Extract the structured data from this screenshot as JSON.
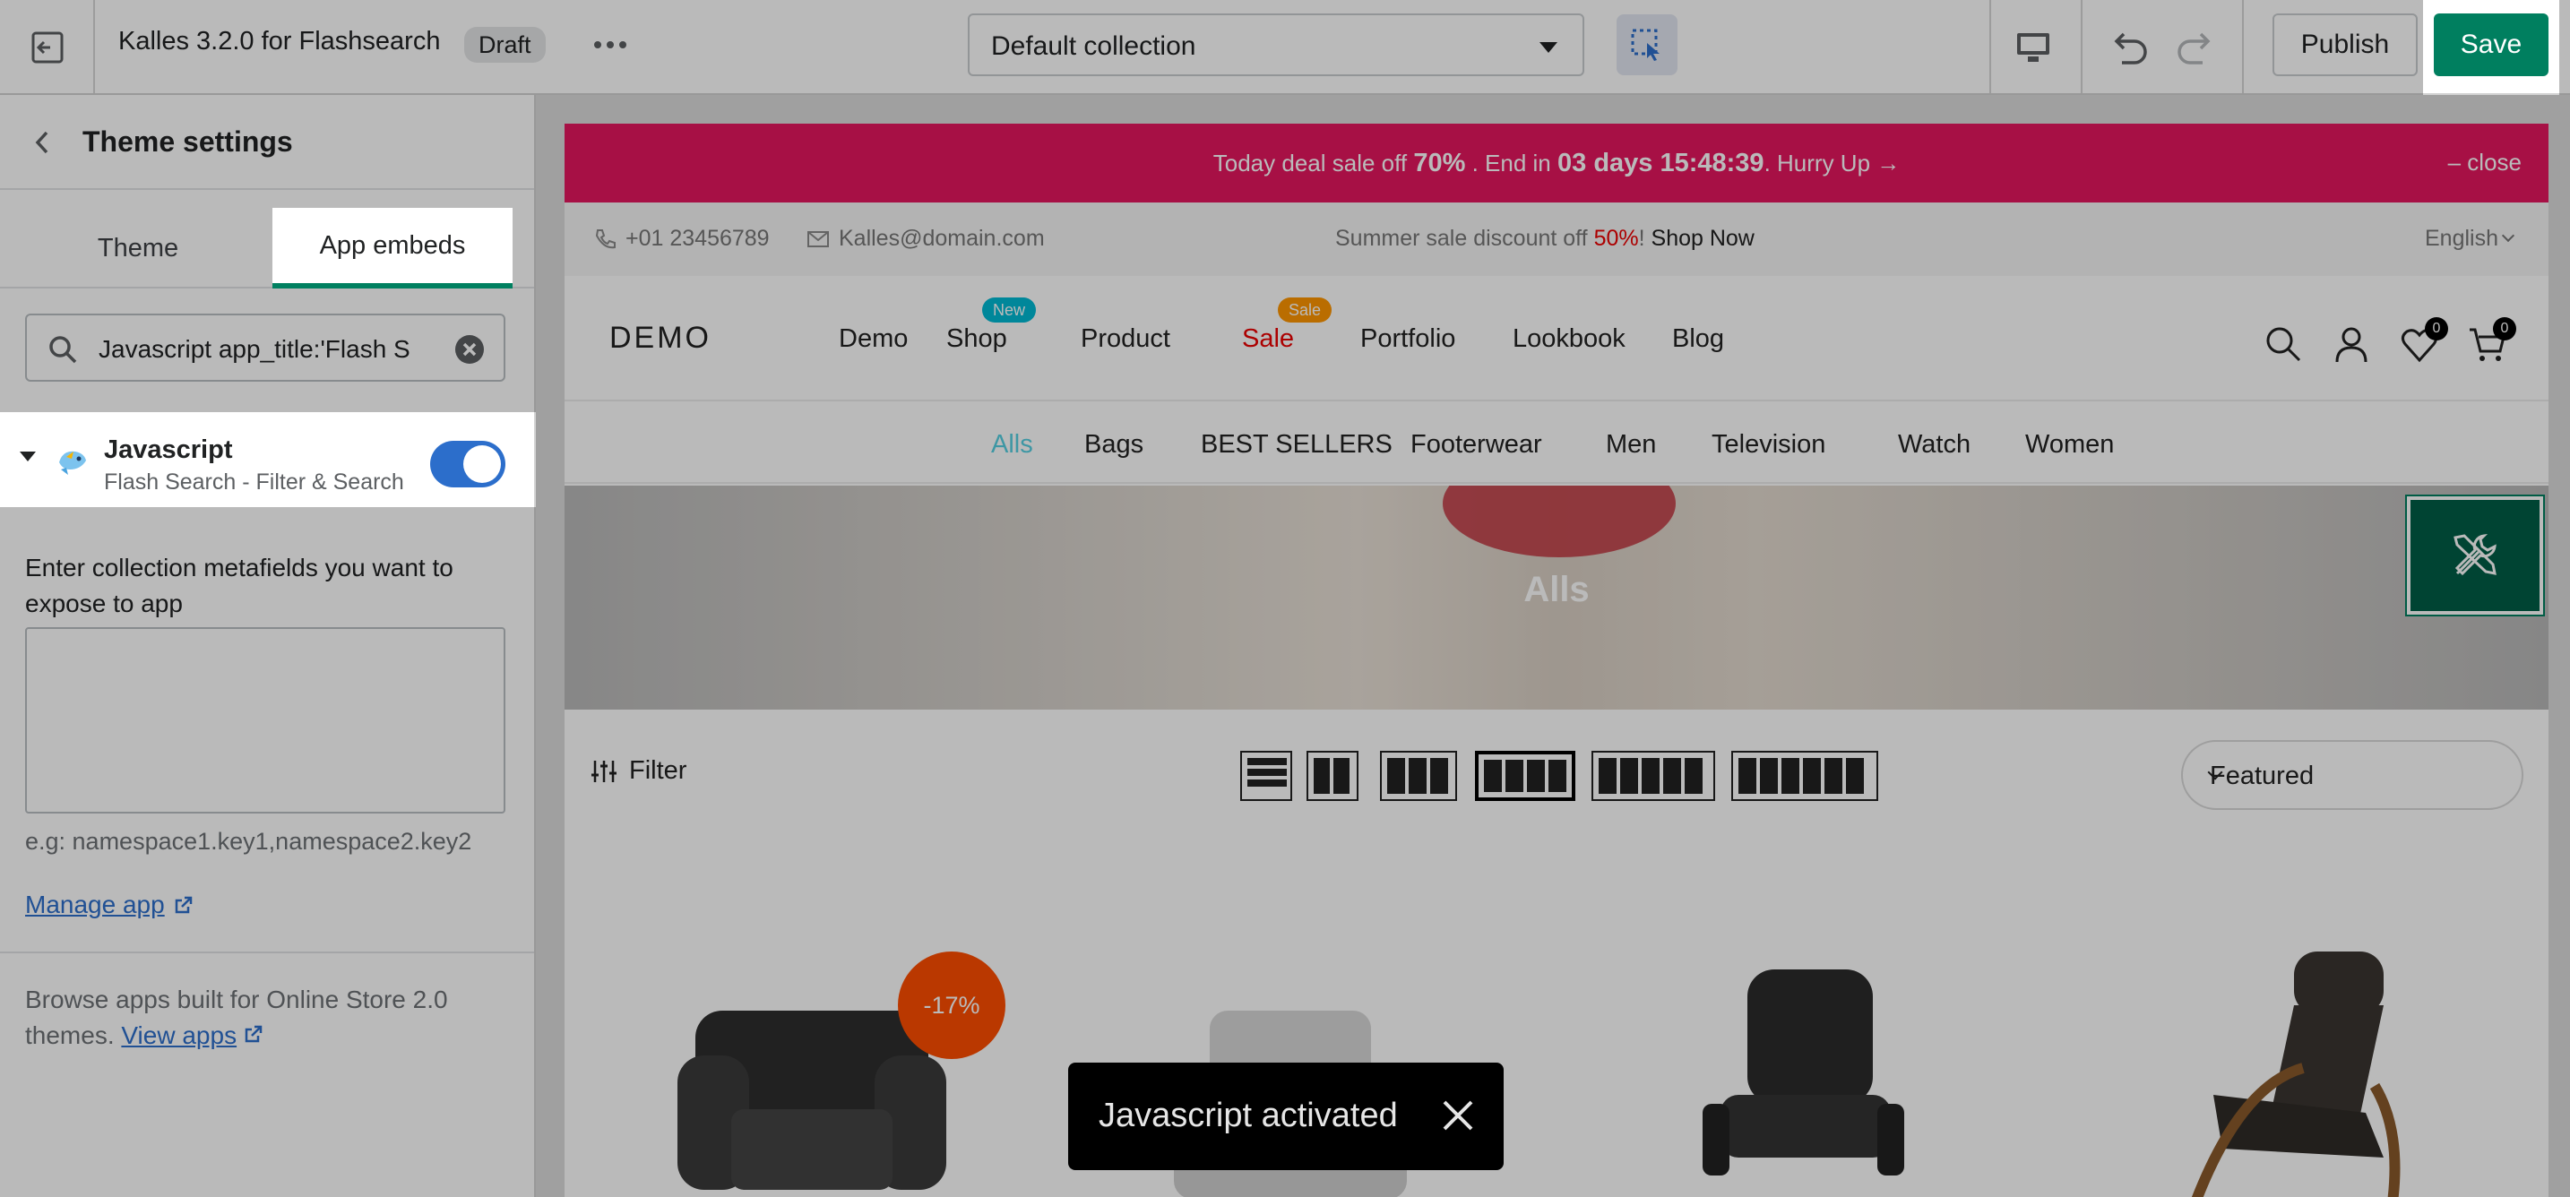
{
  "topbar": {
    "title": "Kalles 3.2.0 for Flashsearch",
    "status_badge": "Draft",
    "template_select": "Default collection",
    "publish_label": "Publish",
    "save_label": "Save"
  },
  "sidebar": {
    "title": "Theme settings",
    "tabs": [
      {
        "label": "Theme",
        "active": false
      },
      {
        "label": "App embeds",
        "active": true
      }
    ],
    "search_value": "Javascript app_title:'Flash S",
    "embed": {
      "name": "Javascript",
      "subtitle": "Flash Search - Filter & Search",
      "enabled": true
    },
    "metafields_label": "Enter collection metafields you want to expose to app",
    "metafields_value": "",
    "metafields_hint": "e.g: namespace1.key1,namespace2.key2",
    "manage_app_label": "Manage app",
    "browse_text": "Browse apps built for Online Store 2.0 themes.",
    "view_apps_label": "View apps"
  },
  "preview": {
    "promo": {
      "prefix": "Today deal sale off ",
      "percent": "70%",
      "middle": " . End in ",
      "countdown": "03 days 15:48:39",
      "suffix": ". Hurry Up →",
      "close_label": "– close"
    },
    "infobar": {
      "phone": "+01 23456789",
      "email": "Kalles@domain.com",
      "sale_prefix": "Summer sale discount off ",
      "sale_percent": "50%",
      "sale_bang": "! ",
      "shop_now": "Shop Now",
      "language": "English"
    },
    "logo": "DEMO",
    "menu": [
      {
        "label": "Demo"
      },
      {
        "label": "Shop",
        "badge": "New"
      },
      {
        "label": "Product"
      },
      {
        "label": "Sale",
        "badge": "Sale"
      },
      {
        "label": "Portfolio"
      },
      {
        "label": "Lookbook"
      },
      {
        "label": "Blog"
      }
    ],
    "wishlist_count": "0",
    "cart_count": "0",
    "categories": [
      "Alls",
      "Bags",
      "BEST SELLERS",
      "Footerwear",
      "Men",
      "Television",
      "Watch",
      "Women"
    ],
    "hero_title": "Alls",
    "filter_label": "Filter",
    "sort_value": "Featured",
    "discount_badge": "-17%"
  },
  "toast": {
    "message": "Javascript activated"
  },
  "colors": {
    "save_green": "#007f5f",
    "promo_pink": "#e5175f",
    "toggle_blue": "#2c6ecb",
    "discount_orange": "#ff4e00"
  }
}
